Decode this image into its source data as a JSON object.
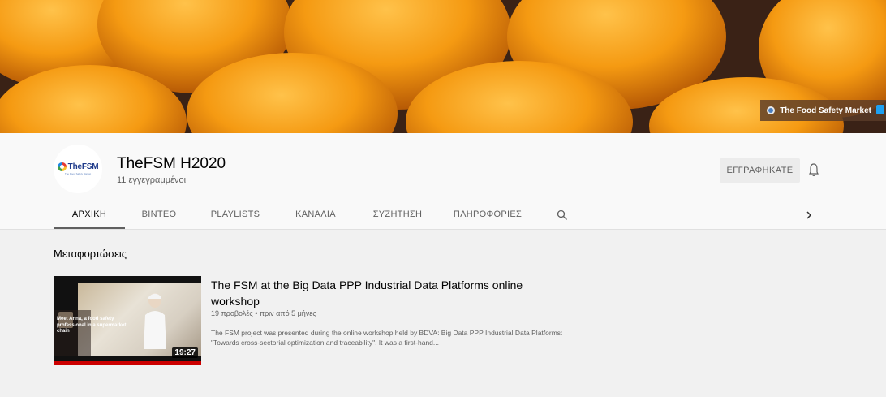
{
  "banner": {
    "link_label": "The Food Safety Market",
    "link_icon": "globe-icon",
    "social_icon": "twitter-icon"
  },
  "channel": {
    "name": "TheFSM H2020",
    "subscribers": "11 εγγεγραμμένοι",
    "avatar_text": "TheFSM",
    "avatar_subtext": "The Food Safety Market",
    "subscribe_label": "ΕΓΓΡΑΦΗΚΑΤΕ",
    "bell_icon": "bell-icon"
  },
  "tabs": [
    {
      "label": "ΑΡΧΙΚΗ",
      "active": true
    },
    {
      "label": "ΒΙΝΤΕΟ",
      "active": false
    },
    {
      "label": "PLAYLISTS",
      "active": false
    },
    {
      "label": "ΚΑΝΑΛΙΑ",
      "active": false
    },
    {
      "label": "ΣΥΖΗΤΗΣΗ",
      "active": false
    },
    {
      "label": "ΠΛΗΡΟΦΟΡΙΕΣ",
      "active": false
    }
  ],
  "section": {
    "title": "Μεταφορτώσεις"
  },
  "video": {
    "title": "The FSM at the Big Data PPP Industrial Data Platforms online workshop",
    "meta": "19 προβολές • πριν από 5 μήνες",
    "description": "The FSM project was presented during the online workshop held by BDVA: Big Data PPP Industrial Data Platforms: \"Towards cross-sectorial optimization and traceability\". It was a first-hand...",
    "duration": "19:27",
    "thumbnail_caption": "Meet Anna, a food safety professional in a supermarket chain",
    "watched_fraction": 1.0
  },
  "colors": {
    "page_bg": "#f1f1f1",
    "header_bg": "#f9f9f9",
    "progress": "#cc0000",
    "subscribe_bg": "#ececec"
  }
}
